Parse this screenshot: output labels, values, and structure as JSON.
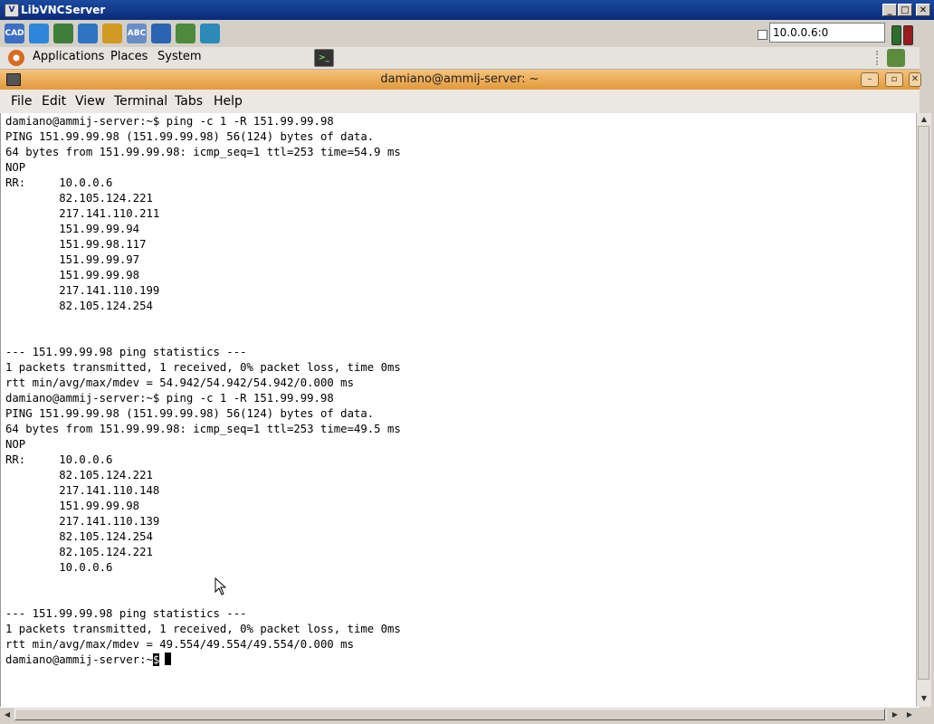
{
  "vnc": {
    "title": "LibVNCServer",
    "host": "10.0.0.6:0",
    "buttons": {
      "minimize": "_",
      "maximize": "□",
      "close": "✕"
    }
  },
  "toolbar_icons": [
    {
      "name": "send-ctrl-alt-del-icon",
      "label": "CAD",
      "color": "#3a6fc4"
    },
    {
      "name": "fullscreen-icon",
      "label": "",
      "color": "#2d86d9"
    },
    {
      "name": "options-icon",
      "label": "",
      "color": "#3f7d3a"
    },
    {
      "name": "refresh-icon",
      "label": "",
      "color": "#2f74c0"
    },
    {
      "name": "windows-key-icon",
      "label": "",
      "color": "#d09a23"
    },
    {
      "name": "text-chat-icon",
      "label": "ABC",
      "color": "#6a8cc8"
    },
    {
      "name": "clipboard-icon",
      "label": "",
      "color": "#2b64b3"
    },
    {
      "name": "disconnect-icon",
      "label": "",
      "color": "#4c8a3d"
    },
    {
      "name": "file-transfer-icon",
      "label": "",
      "color": "#2b8ab8"
    }
  ],
  "panel": {
    "menus": [
      "Applications",
      "Places",
      "System"
    ]
  },
  "terminal": {
    "title": "damiano@ammij-server: ~",
    "menu": [
      "File",
      "Edit",
      "View",
      "Terminal",
      "Tabs",
      "Help"
    ],
    "lines": [
      "damiano@ammij-server:~$ ping -c 1 -R 151.99.99.98",
      "PING 151.99.99.98 (151.99.99.98) 56(124) bytes of data.",
      "64 bytes from 151.99.99.98: icmp_seq=1 ttl=253 time=54.9 ms",
      "NOP",
      "RR:     10.0.0.6",
      "        82.105.124.221",
      "        217.141.110.211",
      "        151.99.99.94",
      "        151.99.98.117",
      "        151.99.99.97",
      "        151.99.99.98",
      "        217.141.110.199",
      "        82.105.124.254",
      "",
      "",
      "--- 151.99.99.98 ping statistics ---",
      "1 packets transmitted, 1 received, 0% packet loss, time 0ms",
      "rtt min/avg/max/mdev = 54.942/54.942/54.942/0.000 ms",
      "damiano@ammij-server:~$ ping -c 1 -R 151.99.99.98",
      "PING 151.99.99.98 (151.99.99.98) 56(124) bytes of data.",
      "64 bytes from 151.99.99.98: icmp_seq=1 ttl=253 time=49.5 ms",
      "NOP",
      "RR:     10.0.0.6",
      "        82.105.124.221",
      "        217.141.110.148",
      "        151.99.99.98",
      "        217.141.110.139",
      "        82.105.124.254",
      "        82.105.124.221",
      "        10.0.0.6",
      "",
      "",
      "--- 151.99.99.98 ping statistics ---",
      "1 packets transmitted, 1 received, 0% packet loss, time 0ms",
      "rtt min/avg/max/mdev = 49.554/49.554/49.554/0.000 ms"
    ],
    "prompt": "damiano@ammij-server:~",
    "prompt_sel": "$"
  }
}
